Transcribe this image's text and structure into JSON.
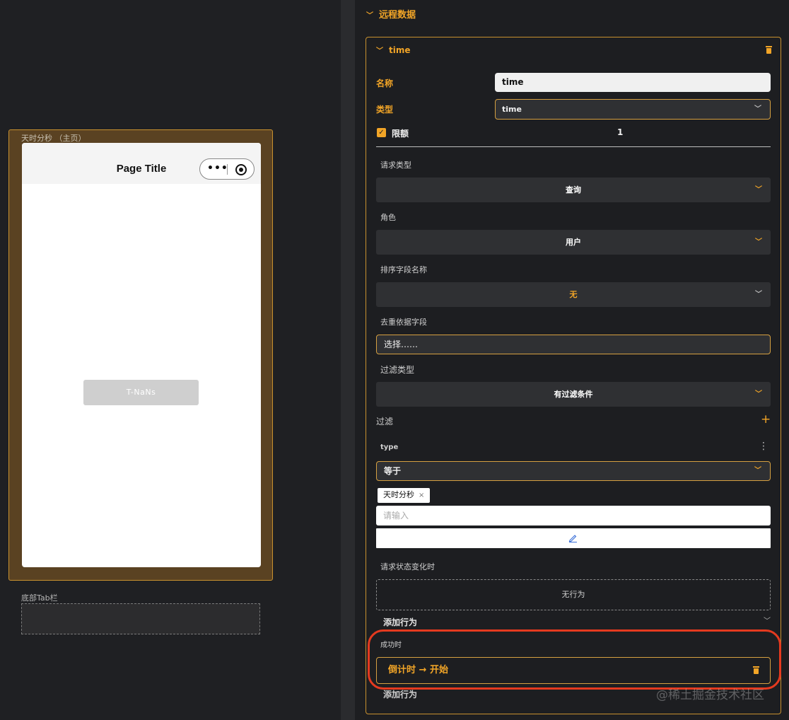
{
  "canvas": {
    "page_label": "天时分秒 （主页）",
    "phone": {
      "title": "Page Title",
      "capsule_dots": "•••",
      "button_text": "T-NaNs"
    },
    "tabbar_label": "底部Tab栏"
  },
  "panel": {
    "section_title": "远程数据",
    "item": {
      "name": "time",
      "fields": {
        "name_label": "名称",
        "name_value": "time",
        "type_label": "类型",
        "type_value": "time",
        "limit_label": "限额",
        "limit_value": "1",
        "limit_checked": true,
        "request_type_label": "请求类型",
        "request_type_value": "查询",
        "role_label": "角色",
        "role_value": "用户",
        "sort_field_label": "排序字段名称",
        "sort_field_value": "无",
        "dedupe_label": "去重依据字段",
        "dedupe_placeholder": "选择……",
        "filter_type_label": "过滤类型",
        "filter_type_value": "有过滤条件",
        "filter_label": "过滤",
        "filter_add": "+",
        "condition": {
          "field": "type",
          "menu": "⋮",
          "operator": "等于",
          "tag": "天时分秒",
          "tag_close": "×",
          "input_placeholder": "请输入"
        },
        "on_state_change_label": "请求状态变化时",
        "no_action_text": "无行为",
        "add_action_label": "添加行为",
        "on_success_label": "成功时",
        "success_action": "倒计时 → 开始",
        "add_action_label_2": "添加行为"
      }
    }
  },
  "watermark": "@稀土掘金技术社区",
  "colors": {
    "accent": "#f2a527",
    "highlight": "#e53a1f",
    "panel_bg": "#1d1e21"
  }
}
